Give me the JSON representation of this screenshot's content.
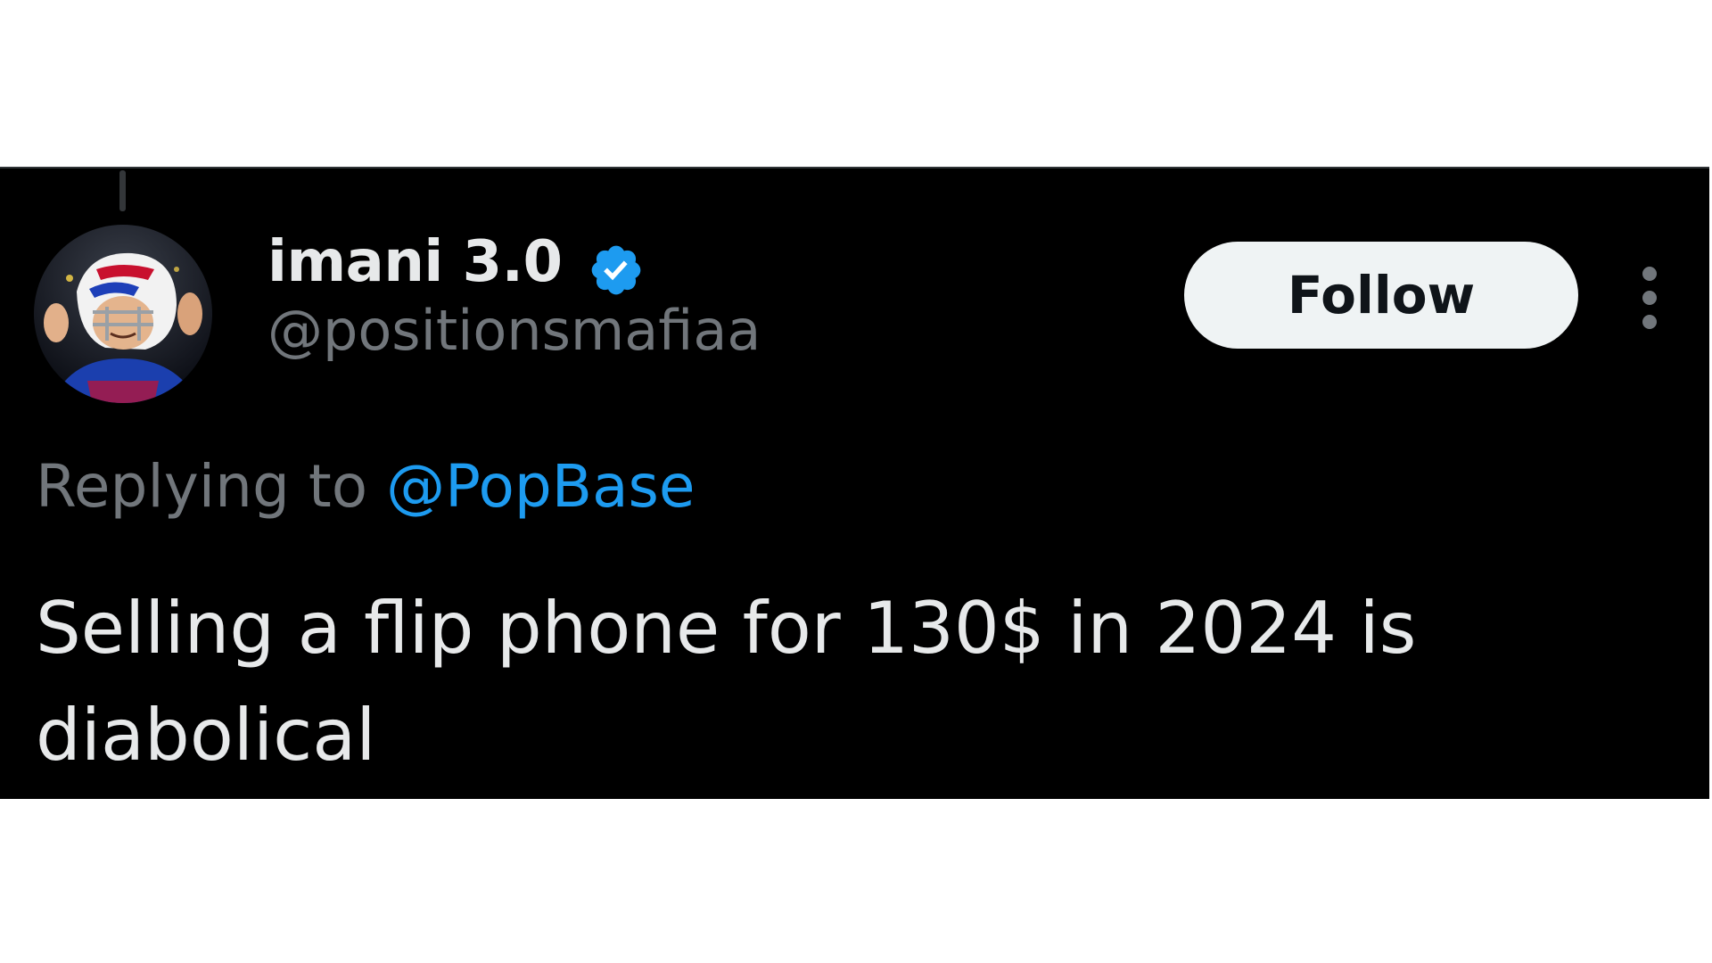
{
  "tweet": {
    "author": {
      "display_name": "imani 3.0",
      "handle": "@positionsmafiaa",
      "verified": true,
      "avatar_icon": "football-player-avatar"
    },
    "follow_label": "Follow",
    "more_icon": "more-options-icon",
    "reply": {
      "prefix": "Replying to",
      "mention": "@PopBase"
    },
    "text": "Selling a flip phone for 130$ in 2024 is diabolical"
  },
  "colors": {
    "background": "#000000",
    "page": "#ffffff",
    "text_primary": "#e7e9ea",
    "text_secondary": "#71767b",
    "accent": "#1d9bf0",
    "follow_button_bg": "#eff3f4"
  }
}
